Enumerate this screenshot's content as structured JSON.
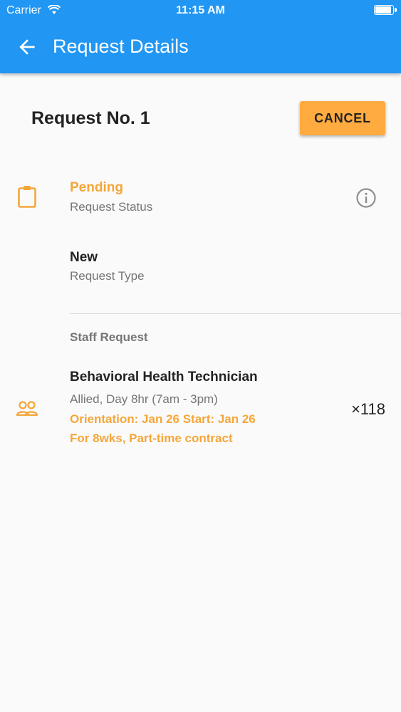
{
  "status_bar": {
    "carrier": "Carrier",
    "time": "11:15 AM"
  },
  "app_bar": {
    "title": "Request Details"
  },
  "request": {
    "title": "Request No. 1",
    "cancel_label": "CANCEL",
    "status_value": "Pending",
    "status_label": "Request Status",
    "type_value": "New",
    "type_label": "Request Type"
  },
  "staff_request": {
    "header": "Staff Request",
    "position": "Behavioral Health Technician",
    "shift": "Allied, Day 8hr (7am - 3pm)",
    "dates": "Orientation: Jan 26 Start: Jan 26",
    "duration": "For 8wks, Part-time contract",
    "count": "×118"
  },
  "colors": {
    "primary": "#2196f3",
    "accent": "#ffab40",
    "accent_text": "#f5a63a"
  },
  "icons": [
    "back-arrow-icon",
    "wifi-icon",
    "battery-icon",
    "clipboard-icon",
    "info-icon",
    "people-icon"
  ]
}
